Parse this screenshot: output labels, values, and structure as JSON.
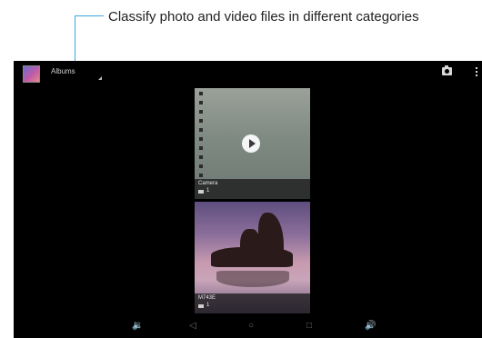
{
  "callout": {
    "text": "Classify photo and video files in different categories"
  },
  "action_bar": {
    "title": "Albums",
    "app_icon": "gallery-icon",
    "camera_icon": "camera-icon",
    "menu_icon": "overflow-menu-icon"
  },
  "albums": [
    {
      "name": "Camera",
      "count": "1",
      "count_icon": "camera-icon",
      "has_video": true
    },
    {
      "name": "M743E",
      "count": "1",
      "count_icon": "folder-icon"
    }
  ],
  "nav_bar": {
    "volume_down": "volume-down-icon",
    "back": "back-icon",
    "home": "home-icon",
    "recents": "recents-icon",
    "volume_up": "volume-up-icon"
  },
  "colors": {
    "callout_line": "#3aa7e0",
    "screen_background": "#000000"
  }
}
